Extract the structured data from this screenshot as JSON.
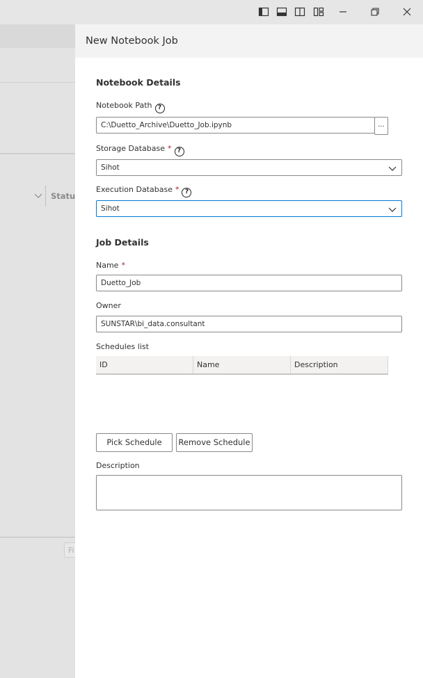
{
  "background": {
    "status_column_label": "Status",
    "filter_placeholder": "Fi"
  },
  "dialog": {
    "title": "New Notebook Job",
    "notebook_details": {
      "heading": "Notebook Details",
      "path_label": "Notebook Path",
      "path_value": "C:\\Duetto_Archive\\Duetto_Job.ipynb",
      "browse_label": "...",
      "storage_label": "Storage Database",
      "storage_value": "Sihot",
      "execution_label": "Execution Database",
      "execution_value": "Sihot"
    },
    "job_details": {
      "heading": "Job Details",
      "name_label": "Name",
      "name_value": "Duetto_Job",
      "owner_label": "Owner",
      "owner_value": "SUNSTAR\\bi_data.consultant",
      "schedules_label": "Schedules list",
      "columns": [
        "ID",
        "Name",
        "Description"
      ],
      "pick_schedule_label": "Pick Schedule",
      "remove_schedule_label": "Remove Schedule",
      "description_label": "Description",
      "description_value": ""
    },
    "required_marker": "*",
    "help_glyph": "?"
  },
  "colors": {
    "accent": "#0078d4",
    "required": "#a4262c",
    "header_bg": "#f3f3f3"
  },
  "icons": {
    "window_controls": [
      "toggle-primary-sidebar-icon",
      "toggle-panel-icon",
      "toggle-secondary-sidebar-icon",
      "customize-layout-icon",
      "minimize-icon",
      "restore-icon",
      "close-icon"
    ]
  }
}
